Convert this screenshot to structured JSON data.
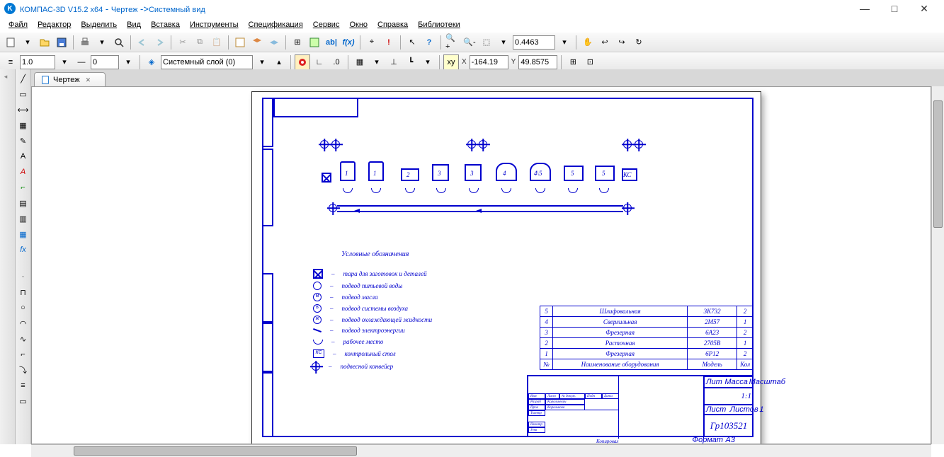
{
  "titlebar": {
    "app": "КОМПАС-3D V15.2  x64",
    "doc": "Чертеж",
    "view": "Системный вид"
  },
  "win": {
    "min": "—",
    "max": "□",
    "close": "✕"
  },
  "menu": [
    "Файл",
    "Редактор",
    "Выделить",
    "Вид",
    "Вставка",
    "Инструменты",
    "Спецификация",
    "Сервис",
    "Окно",
    "Справка",
    "Библиотеки"
  ],
  "toolbar2": {
    "scale": "1.0",
    "step": "0",
    "layer": "Системный слой (0)",
    "zoom": "0.4463",
    "coord_x": "-164.19",
    "coord_y": "49.8575"
  },
  "tab": {
    "name": "Чертеж"
  },
  "drawing": {
    "legend_title": "Условные обозначения",
    "legend": [
      "тара для заготовок и деталей",
      "подвод питьевой воды",
      "подвод масла",
      "подвод системы воздуха",
      "подвод охлаждающей жидкости",
      "подвод электроэнергии",
      "рабочее место",
      "контрольный стол",
      "подвесной конвейер"
    ],
    "kc_label": "КС",
    "spec": {
      "headers": [
        "№",
        "Наименование оборудования",
        "Модель",
        "Кол"
      ],
      "rows": [
        [
          "5",
          "Шлифовальная",
          "3К732",
          "2"
        ],
        [
          "4",
          "Сверлильная",
          "2М57",
          "1"
        ],
        [
          "3",
          "Фрезерная",
          "6А23",
          "2"
        ],
        [
          "2",
          "Расточная",
          "2705В",
          "1"
        ],
        [
          "1",
          "Фрезерная",
          "6Р12",
          "2"
        ]
      ]
    },
    "stamp": {
      "group": "Гр103521",
      "scale": "1:1",
      "lit": "Лит",
      "massa": "Масса",
      "mash": "Масштаб",
      "list": "Лист",
      "listov": "Листов",
      "c": "1",
      "copied": "Копировал",
      "format": "Формат",
      "a3": "А3",
      "tiny": [
        "Изм",
        "Лист",
        "№ докум.",
        "Подп",
        "Дата",
        "Разраб",
        "Королькевич",
        "Пров",
        "Королькова",
        "Тконтр",
        "",
        "Нконтр",
        "",
        "Утв",
        ""
      ]
    },
    "machine_labels": [
      "1",
      "1",
      "2",
      "3",
      "3",
      "4",
      "4\\5",
      "5",
      "5",
      "КС"
    ]
  }
}
